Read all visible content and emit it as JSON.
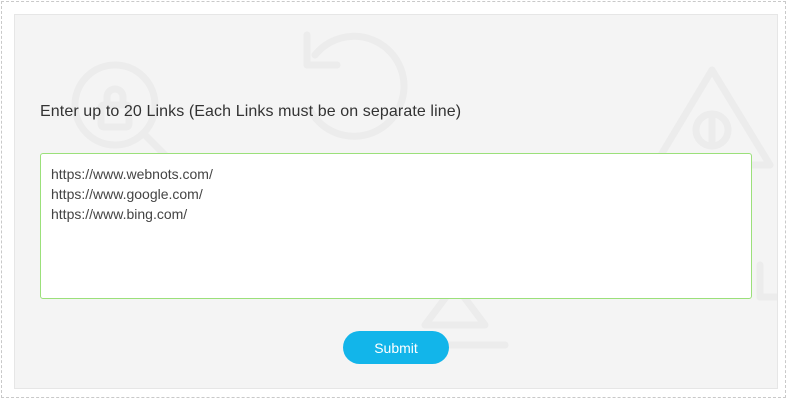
{
  "form": {
    "prompt_label": "Enter up to 20 Links (Each Links must be on separate line)",
    "links_value": "https://www.webnots.com/\nhttps://www.google.com/\nhttps://www.bing.com/",
    "submit_label": "Submit"
  },
  "colors": {
    "panel_background": "#f4f4f4",
    "textarea_border": "#9be07a",
    "submit_background": "#12b5ea",
    "submit_text": "#ffffff"
  },
  "icons": [
    "search-lock-icon",
    "undo-icon",
    "warning-bug-icon",
    "upload-icon"
  ]
}
